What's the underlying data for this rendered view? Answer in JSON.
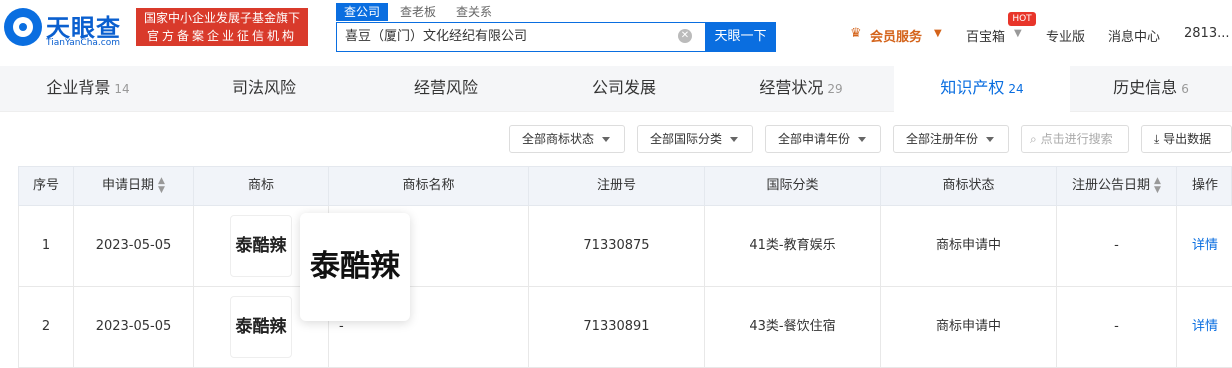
{
  "logo": {
    "name": "天眼查",
    "domain": "TianYanCha.com"
  },
  "badge": {
    "line1": "国家中小企业发展子基金旗下",
    "line2": "官方备案企业征信机构"
  },
  "search": {
    "tabs": [
      "查公司",
      "查老板",
      "查关系"
    ],
    "value": "喜豆（厦门）文化经纪有限公司",
    "button": "天眼一下"
  },
  "topnav": {
    "vip": "会员服务",
    "box": "百宝箱",
    "hot": "HOT",
    "pro": "专业版",
    "msg": "消息中心",
    "user": "2813..."
  },
  "tabs": [
    {
      "label": "企业背景",
      "count": "14"
    },
    {
      "label": "司法风险",
      "count": ""
    },
    {
      "label": "经营风险",
      "count": ""
    },
    {
      "label": "公司发展",
      "count": ""
    },
    {
      "label": "经营状况",
      "count": "29"
    },
    {
      "label": "知识产权",
      "count": "24"
    },
    {
      "label": "历史信息",
      "count": "6"
    }
  ],
  "filters": {
    "status": "全部商标状态",
    "intl": "全部国际分类",
    "apply_year": "全部申请年份",
    "reg_year": "全部注册年份",
    "search_placeholder": "点击进行搜索",
    "export": "导出数据"
  },
  "columns": [
    "序号",
    "申请日期",
    "商标",
    "商标名称",
    "注册号",
    "国际分类",
    "商标状态",
    "注册公告日期",
    "操作"
  ],
  "rows": [
    {
      "no": "1",
      "date": "2023-05-05",
      "mark": "泰酷辣",
      "name": "",
      "reg": "71330875",
      "class": "41类-教育娱乐",
      "status": "商标申请中",
      "pub": "-",
      "action": "详情"
    },
    {
      "no": "2",
      "date": "2023-05-05",
      "mark": "泰酷辣",
      "name": "-",
      "reg": "71330891",
      "class": "43类-餐饮住宿",
      "status": "商标申请中",
      "pub": "-",
      "action": "详情"
    }
  ],
  "popup": {
    "text": "泰酷辣"
  }
}
